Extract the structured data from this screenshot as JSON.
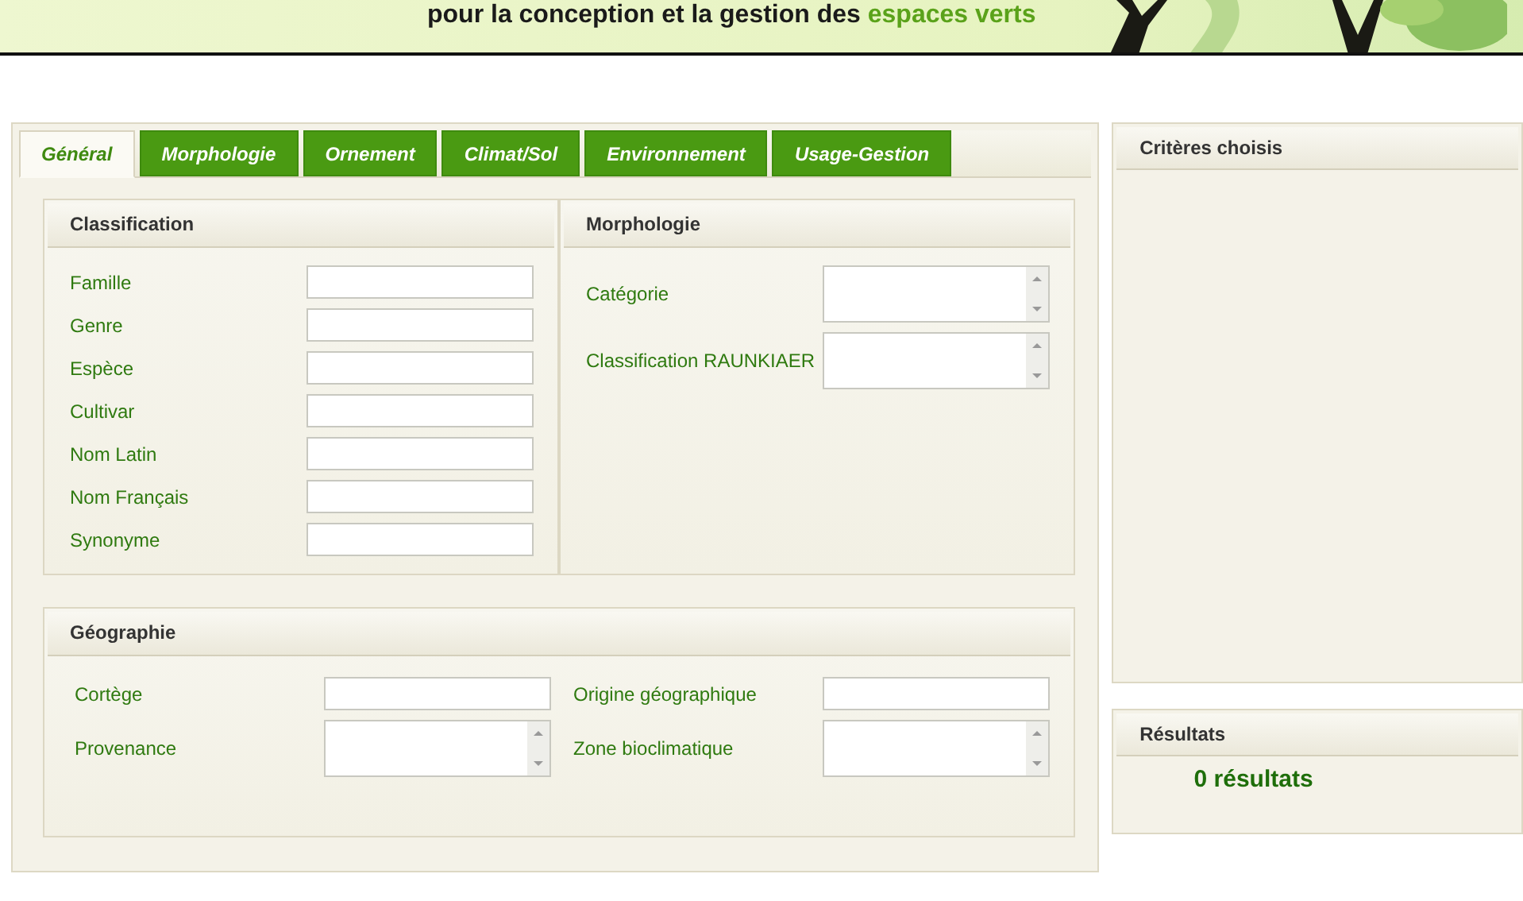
{
  "banner": {
    "tagline": "pour la conception et la gestion des **espaces verts**"
  },
  "tabs": [
    {
      "label": "Général",
      "selected": true
    },
    {
      "label": "Morphologie",
      "selected": false
    },
    {
      "label": "Ornement",
      "selected": false
    },
    {
      "label": "Climat/Sol",
      "selected": false
    },
    {
      "label": "Environnement",
      "selected": false
    },
    {
      "label": "Usage-Gestion",
      "selected": false
    }
  ],
  "sections": [
    {
      "title": "Classification",
      "kind": "single",
      "fields": [
        {
          "label": "Famille",
          "kind": "text"
        },
        {
          "label": "Genre",
          "kind": "text"
        },
        {
          "label": "Espèce",
          "kind": "text"
        },
        {
          "label": "Cultivar",
          "kind": "text"
        },
        {
          "label": "Nom Latin",
          "kind": "text"
        },
        {
          "label": "Nom Français",
          "kind": "text"
        },
        {
          "label": "Synonyme",
          "kind": "text"
        }
      ]
    },
    {
      "title": "Morphologie",
      "kind": "single",
      "fields": [
        {
          "label": "Catégorie",
          "kind": "list"
        },
        {
          "label": "Classification RAUNKIAER",
          "kind": "list"
        }
      ]
    },
    {
      "title": "Géographie",
      "kind": "double",
      "fields": [
        {
          "label": "Cortège",
          "kind": "text"
        },
        {
          "label": "Origine géographique",
          "kind": "text"
        },
        {
          "label": "Provenance",
          "kind": "list"
        },
        {
          "label": "Zone bioclimatique",
          "kind": "list"
        }
      ]
    }
  ],
  "criteria": {
    "title": "Critères choisis"
  },
  "results": {
    "title": "Résultats",
    "count": "0 résultats"
  }
}
